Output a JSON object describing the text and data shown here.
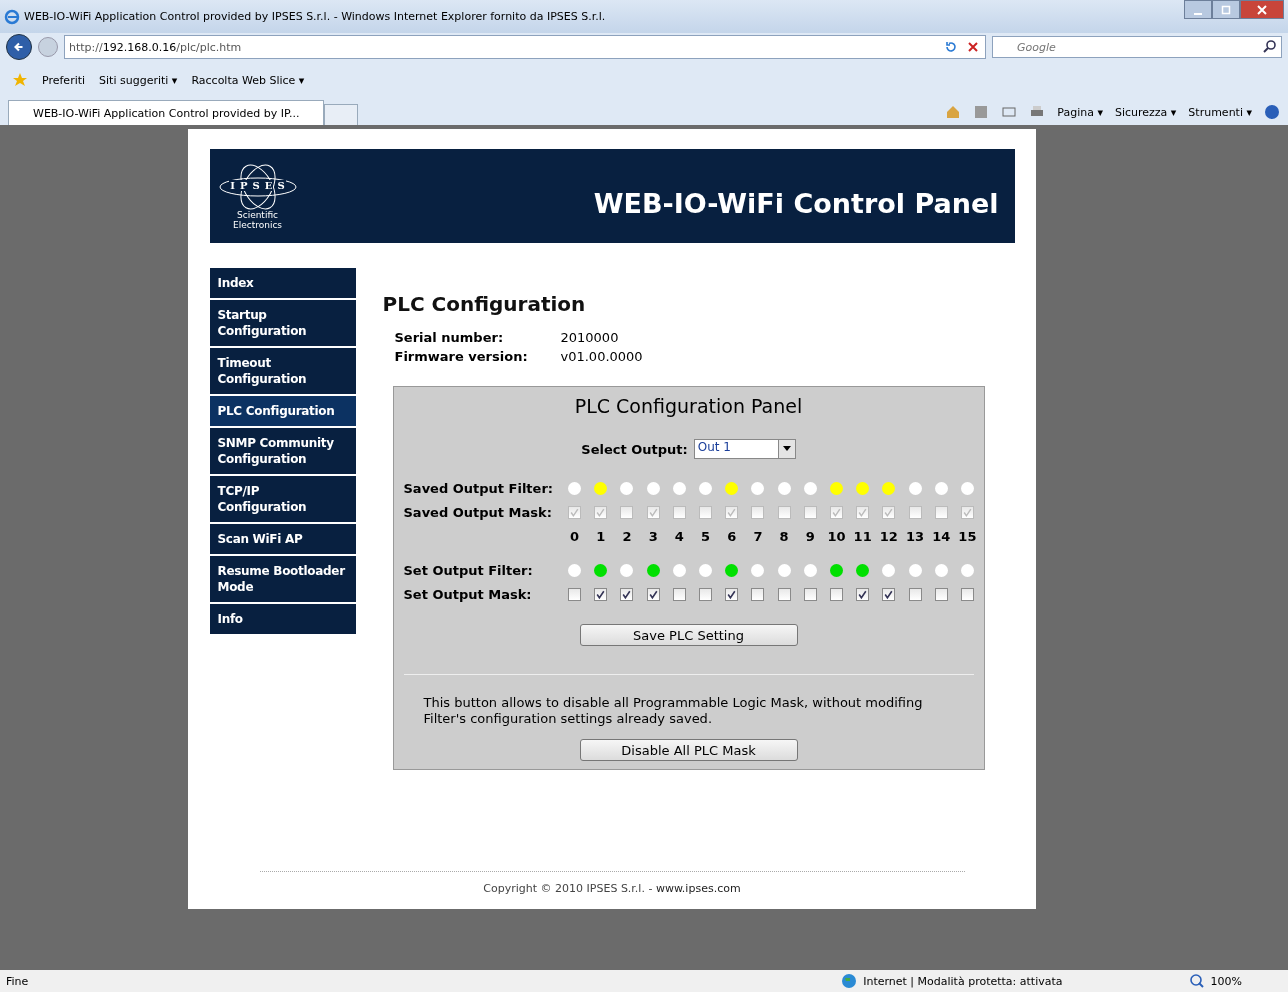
{
  "window": {
    "title": "WEB-IO-WiFi Application Control provided by IPSES S.r.l. - Windows Internet Explorer fornito da IPSES S.r.l."
  },
  "address_bar": {
    "url_prefix": "http://",
    "url_host": "192.168.0.16",
    "url_path": "/plc/plc.htm"
  },
  "search_field": {
    "placeholder": "Google"
  },
  "favorites_bar": {
    "favorites": "Preferiti",
    "items": [
      "Siti suggeriti ▾",
      "Raccolta Web Slice ▾"
    ]
  },
  "tab": {
    "title": "WEB-IO-WiFi Application Control provided by IP..."
  },
  "command_bar": [
    "Pagina ▾",
    "Sicurezza ▾",
    "Strumenti ▾"
  ],
  "header": {
    "logo_letters": [
      "I",
      "P",
      "S",
      "E",
      "S"
    ],
    "logo_sub": [
      "Scientific",
      "Electronics"
    ],
    "title": "WEB-IO-WiFi Control Panel"
  },
  "nav": [
    {
      "label": "Index",
      "selected": false
    },
    {
      "label": "Startup Configuration",
      "selected": false
    },
    {
      "label": "Timeout Configuration",
      "selected": false
    },
    {
      "label": "PLC Configuration",
      "selected": true
    },
    {
      "label": "SNMP Community Configuration",
      "selected": false
    },
    {
      "label": "TCP/IP Configuration",
      "selected": false
    },
    {
      "label": "Scan WiFi AP",
      "selected": false
    },
    {
      "label": "Resume Bootloader Mode",
      "selected": false
    },
    {
      "label": "Info",
      "selected": false
    }
  ],
  "page_title": "PLC Configuration",
  "info": [
    {
      "label": "Serial number:",
      "value": "2010000"
    },
    {
      "label": "Firmware version:",
      "value": "v01.00.0000"
    }
  ],
  "panel": {
    "title": "PLC Configuration Panel",
    "select_label": "Select Output:",
    "select_value": "Out 1",
    "row_labels": {
      "saved_filter": "Saved Output Filter:",
      "saved_mask": "Saved Output Mask:",
      "set_filter": "Set Output Filter:",
      "set_mask": "Set Output Mask:"
    },
    "outputs": [
      {
        "label": "0",
        "saved_filter_on": false,
        "saved_mask_checked": true,
        "set_filter_on": false,
        "set_mask_checked": false
      },
      {
        "label": "1",
        "saved_filter_on": true,
        "saved_mask_checked": true,
        "set_filter_on": true,
        "set_mask_checked": true
      },
      {
        "label": "2",
        "saved_filter_on": false,
        "saved_mask_checked": false,
        "set_filter_on": false,
        "set_mask_checked": true
      },
      {
        "label": "3",
        "saved_filter_on": false,
        "saved_mask_checked": true,
        "set_filter_on": true,
        "set_mask_checked": true
      },
      {
        "label": "4",
        "saved_filter_on": false,
        "saved_mask_checked": false,
        "set_filter_on": false,
        "set_mask_checked": false
      },
      {
        "label": "5",
        "saved_filter_on": false,
        "saved_mask_checked": false,
        "set_filter_on": false,
        "set_mask_checked": false
      },
      {
        "label": "6",
        "saved_filter_on": true,
        "saved_mask_checked": true,
        "set_filter_on": true,
        "set_mask_checked": true
      },
      {
        "label": "7",
        "saved_filter_on": false,
        "saved_mask_checked": false,
        "set_filter_on": false,
        "set_mask_checked": false
      },
      {
        "label": "8",
        "saved_filter_on": false,
        "saved_mask_checked": false,
        "set_filter_on": false,
        "set_mask_checked": false
      },
      {
        "label": "9",
        "saved_filter_on": false,
        "saved_mask_checked": false,
        "set_filter_on": false,
        "set_mask_checked": false
      },
      {
        "label": "10",
        "saved_filter_on": true,
        "saved_mask_checked": true,
        "set_filter_on": true,
        "set_mask_checked": false
      },
      {
        "label": "11",
        "saved_filter_on": true,
        "saved_mask_checked": true,
        "set_filter_on": true,
        "set_mask_checked": true
      },
      {
        "label": "12",
        "saved_filter_on": true,
        "saved_mask_checked": true,
        "set_filter_on": false,
        "set_mask_checked": true
      },
      {
        "label": "13",
        "saved_filter_on": false,
        "saved_mask_checked": false,
        "set_filter_on": false,
        "set_mask_checked": false
      },
      {
        "label": "14",
        "saved_filter_on": false,
        "saved_mask_checked": false,
        "set_filter_on": false,
        "set_mask_checked": false
      },
      {
        "label": "15",
        "saved_filter_on": false,
        "saved_mask_checked": true,
        "set_filter_on": false,
        "set_mask_checked": false
      }
    ],
    "save_button": "Save PLC Setting",
    "note": "This button allows to disable all Programmable Logic Mask, without modifing Filter's configuration settings already saved.",
    "disable_button": "Disable All PLC Mask"
  },
  "footer": {
    "text": "Copyright © 2010 IPSES S.r.l. - ",
    "link": "www.ipses.com"
  },
  "status_bar": {
    "status": "Fine",
    "zone": "Internet | Modalità protetta: attivata",
    "zoom": "100%"
  }
}
